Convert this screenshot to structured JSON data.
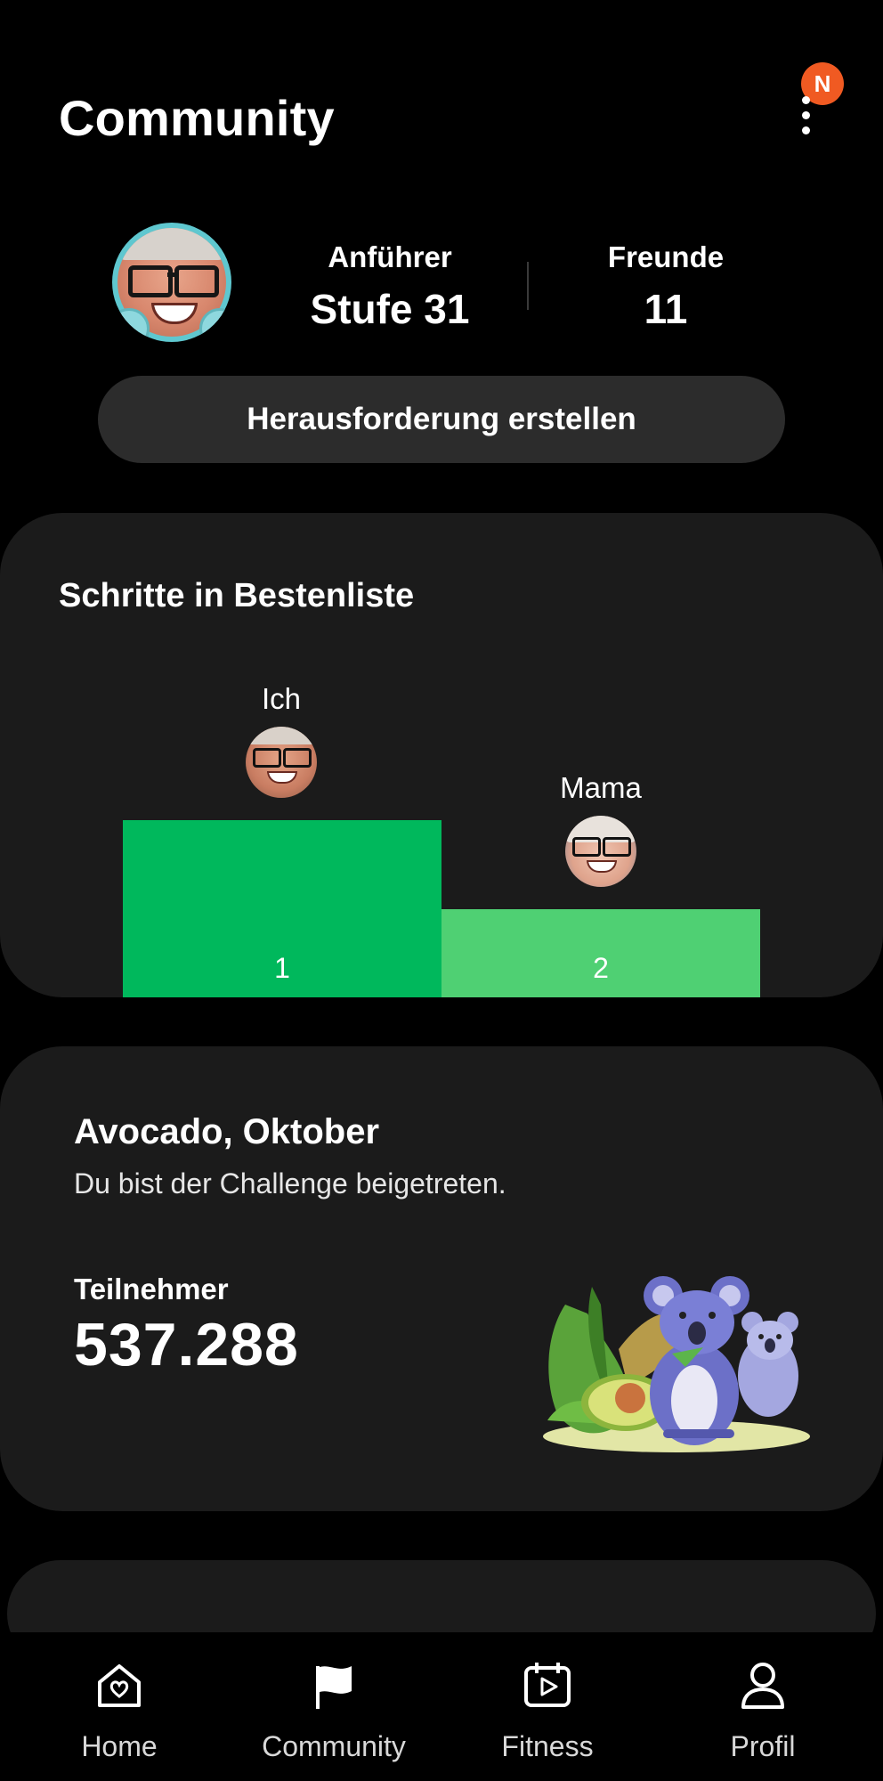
{
  "header": {
    "title": "Community",
    "notification_badge": "N"
  },
  "profile": {
    "stats": [
      {
        "label": "Anführer",
        "value": "Stufe 31"
      },
      {
        "label": "Freunde",
        "value": "11"
      }
    ],
    "create_challenge_label": "Herausforderung erstellen"
  },
  "leaderboard": {
    "title": "Schritte in Bestenliste",
    "entries": [
      {
        "name": "Ich",
        "rank": "1",
        "color": "#00b85c"
      },
      {
        "name": "Mama",
        "rank": "2",
        "color": "#4fd073"
      }
    ]
  },
  "challenge": {
    "title": "Avocado, Oktober",
    "subtitle": "Du bist der Challenge beigetreten.",
    "participants_label": "Teilnehmer",
    "participants_value": "537.288"
  },
  "nav": {
    "items": [
      {
        "label": "Home",
        "icon": "house-heart-icon"
      },
      {
        "label": "Community",
        "icon": "flag-icon"
      },
      {
        "label": "Fitness",
        "icon": "calendar-play-icon"
      },
      {
        "label": "Profil",
        "icon": "person-icon"
      }
    ]
  },
  "colors": {
    "background": "#000000",
    "card": "#1b1b1b",
    "accent": "#00b85c",
    "badge": "#f05a22"
  }
}
